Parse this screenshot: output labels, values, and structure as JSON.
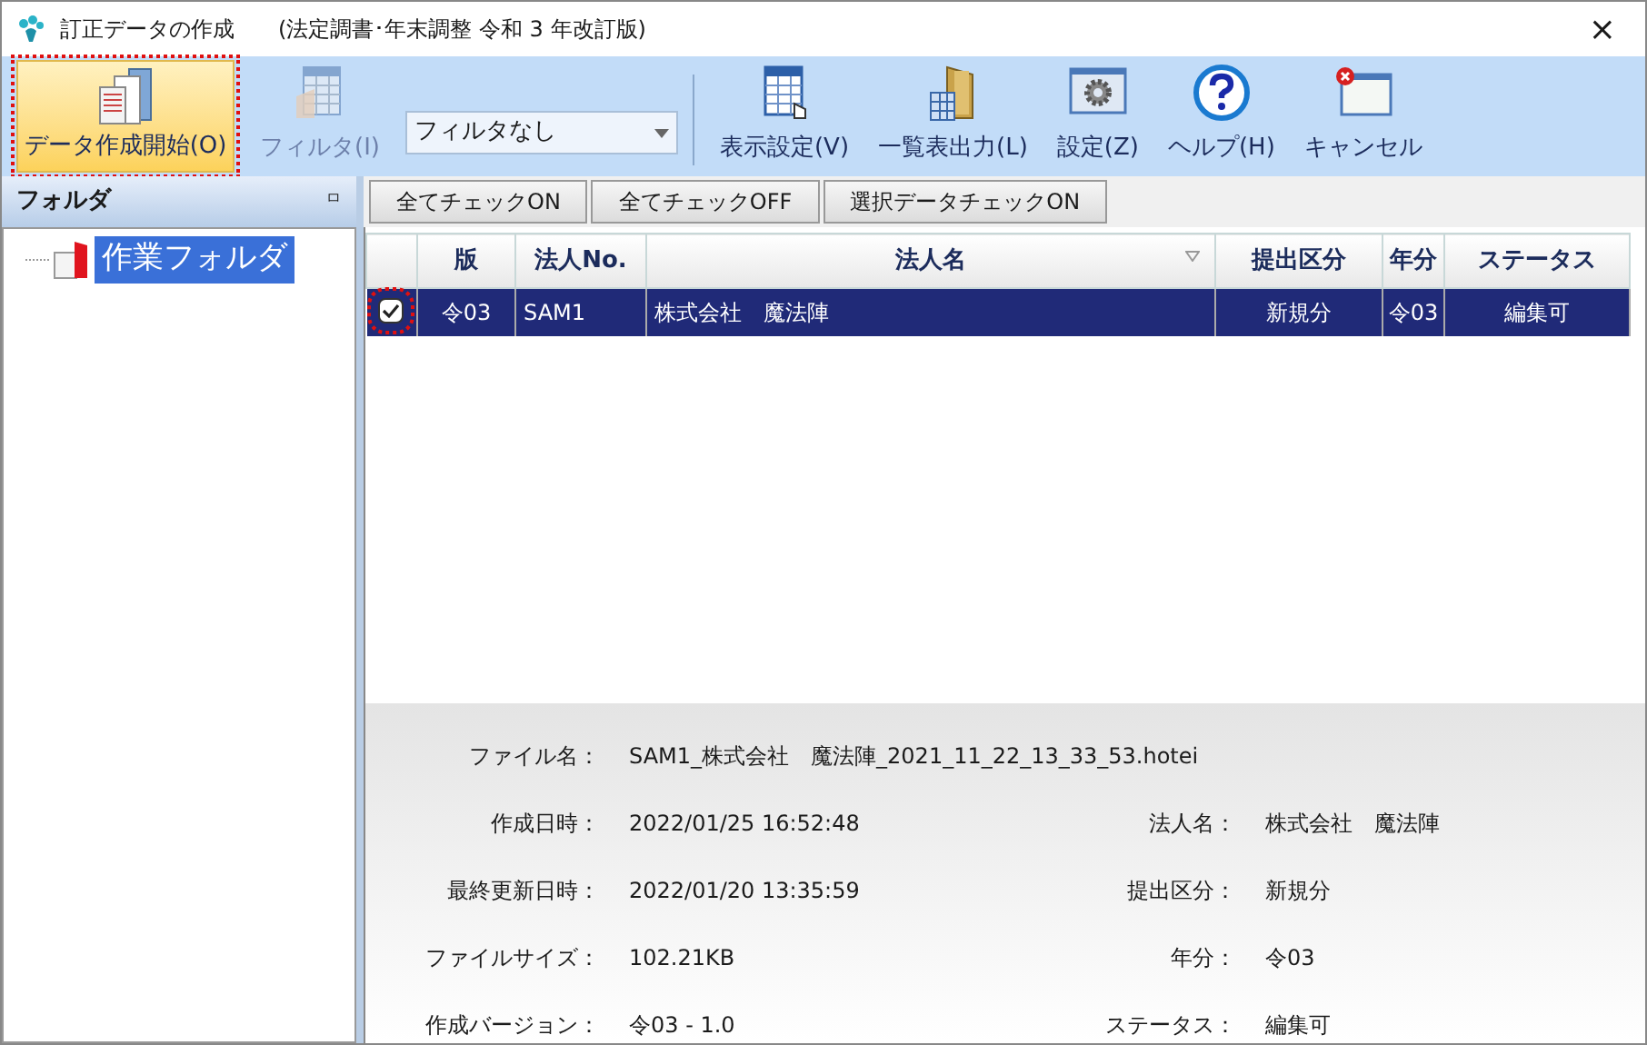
{
  "window": {
    "title": "訂正データの作成",
    "subtitle": "(法定調書･年末調整 令和 3 年改訂版)",
    "close": "×"
  },
  "toolbar": [
    {
      "kind": "start",
      "label": "データ作成開始(O)",
      "highlighted": true,
      "disabled": false
    },
    {
      "kind": "filter",
      "label": "フィルタ(I)",
      "highlighted": false,
      "disabled": true
    },
    {
      "kind": "dropdown",
      "value": "フィルタなし"
    },
    {
      "kind": "view",
      "label": "表示設定(V)",
      "highlighted": false,
      "disabled": false
    },
    {
      "kind": "export",
      "label": "一覧表出力(L)",
      "highlighted": false,
      "disabled": false
    },
    {
      "kind": "settings",
      "label": "設定(Z)",
      "highlighted": false,
      "disabled": false
    },
    {
      "kind": "help",
      "label": "ヘルプ(H)",
      "highlighted": false,
      "disabled": false
    },
    {
      "kind": "cancel",
      "label": "キャンセル",
      "highlighted": false,
      "disabled": false
    }
  ],
  "sidebar": {
    "title": "フォルダ",
    "pin": "ㅁ",
    "items": [
      {
        "label": "作業フォルダ",
        "selected": true
      }
    ]
  },
  "actions": [
    "全てチェックON",
    "全てチェックOFF",
    "選択データチェックON"
  ],
  "table": {
    "columns": [
      "版",
      "法人No.",
      "法人名",
      "提出区分",
      "年分",
      "ステータス"
    ],
    "rows": [
      {
        "checked": true,
        "highlighted": true,
        "selected": true,
        "cells": [
          "令03",
          "SAM1",
          "株式会社　魔法陣",
          "新規分",
          "令03",
          "編集可"
        ]
      }
    ]
  },
  "details": {
    "file": {
      "label": "ファイル名：",
      "value": "SAM1_株式会社　魔法陣_2021_11_22_13_33_53.hotei"
    },
    "left": [
      {
        "label": "作成日時：",
        "value": "2022/01/25 16:52:48"
      },
      {
        "label": "最終更新日時：",
        "value": "2022/01/20 13:35:59"
      },
      {
        "label": "ファイルサイズ：",
        "value": "102.21KB"
      },
      {
        "label": "作成バージョン：",
        "value": "令03 - 1.0"
      }
    ],
    "right": [
      {
        "label": "法人名：",
        "value": "株式会社　魔法陣"
      },
      {
        "label": "提出区分：",
        "value": "新規分"
      },
      {
        "label": "年分：",
        "value": "令03"
      },
      {
        "label": "ステータス：",
        "value": "編集可"
      }
    ]
  }
}
